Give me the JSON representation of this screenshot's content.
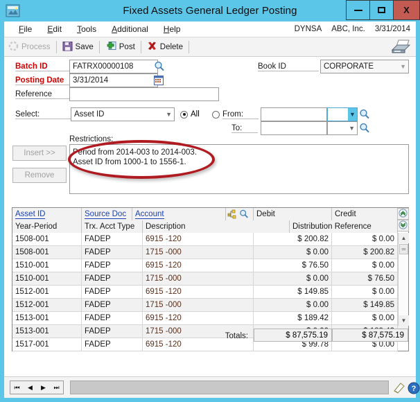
{
  "window": {
    "title": "Fixed Assets General Ledger Posting",
    "app_icon": "app-window-icon",
    "minimize_label": "Minimize",
    "maximize_label": "Maximize",
    "close_label": "X"
  },
  "menubar": {
    "items": [
      {
        "label": "File",
        "accel": "F"
      },
      {
        "label": "Edit",
        "accel": "E"
      },
      {
        "label": "Tools",
        "accel": "T"
      },
      {
        "label": "Additional",
        "accel": "A"
      },
      {
        "label": "Help",
        "accel": "H"
      }
    ],
    "user": "DYNSA",
    "company": "ABC, Inc.",
    "date": "3/31/2014"
  },
  "toolbar": {
    "process_label": "Process",
    "save_label": "Save",
    "post_label": "Post",
    "delete_label": "Delete",
    "print_icon": "printer-icon"
  },
  "form": {
    "batch_id_label": "Batch ID",
    "batch_id_value": "FATRX00000108",
    "posting_date_label": "Posting Date",
    "posting_date_value": "3/31/2014",
    "reference_label": "Reference",
    "reference_value": "",
    "book_id_label": "Book ID",
    "book_id_value": "CORPORATE",
    "select_label": "Select:",
    "select_value": "Asset ID",
    "radio_all_label": "All",
    "radio_all_selected": true,
    "radio_range_selected": false,
    "from_label": "From:",
    "from_value": "",
    "from_code": "",
    "to_label": "To:",
    "to_value": "",
    "to_code": "",
    "restrictions_label": "Restrictions:",
    "restriction_lines": [
      "Period from 2014-003 to 2014-003.",
      "Asset ID from 1000-1 to 1556-1."
    ],
    "insert_label": "Insert >>",
    "remove_label": "Remove"
  },
  "grid": {
    "headers_top": [
      "Asset ID",
      "Source Doc",
      "Account",
      "Debit",
      "Credit"
    ],
    "headers_bottom": [
      "Year-Period",
      "Trx. Acct Type",
      "Description",
      "Distribution Reference"
    ],
    "header_icons": [
      "expand-hierarchy-icon",
      "lookup-magnifier-icon"
    ],
    "scroll_up_icon": "double-chevron-up-icon",
    "scroll_down_icon": "double-chevron-down-icon",
    "rows": [
      {
        "asset_id": "1508-001",
        "source_doc": "FADEP",
        "account": "6915 -120",
        "debit": "$ 200.82",
        "credit": "$ 0.00"
      },
      {
        "asset_id": "1508-001",
        "source_doc": "FADEP",
        "account": "1715 -000",
        "debit": "$ 0.00",
        "credit": "$ 200.82"
      },
      {
        "asset_id": "1510-001",
        "source_doc": "FADEP",
        "account": "6915 -120",
        "debit": "$ 76.50",
        "credit": "$ 0.00"
      },
      {
        "asset_id": "1510-001",
        "source_doc": "FADEP",
        "account": "1715 -000",
        "debit": "$ 0.00",
        "credit": "$ 76.50"
      },
      {
        "asset_id": "1512-001",
        "source_doc": "FADEP",
        "account": "6915 -120",
        "debit": "$ 149.85",
        "credit": "$ 0.00"
      },
      {
        "asset_id": "1512-001",
        "source_doc": "FADEP",
        "account": "1715 -000",
        "debit": "$ 0.00",
        "credit": "$ 149.85"
      },
      {
        "asset_id": "1513-001",
        "source_doc": "FADEP",
        "account": "6915 -120",
        "debit": "$ 189.42",
        "credit": "$ 0.00"
      },
      {
        "asset_id": "1513-001",
        "source_doc": "FADEP",
        "account": "1715 -000",
        "debit": "$ 0.00",
        "credit": "$ 189.42"
      },
      {
        "asset_id": "1517-001",
        "source_doc": "FADEP",
        "account": "6915 -120",
        "debit": "$ 99.78",
        "credit": "$ 0.00"
      }
    ],
    "totals_label": "Totals:",
    "totals_debit": "$ 87,575.19",
    "totals_credit": "$ 87,575.19"
  },
  "statusbar": {
    "nav_first": "first-record-icon",
    "nav_prev": "previous-record-icon",
    "nav_next": "next-record-icon",
    "nav_last": "last-record-icon",
    "note_icon": "note-icon",
    "help_icon": "help-icon",
    "message": ""
  },
  "annotation": {
    "shape": "red-ellipse-highlight",
    "color": "#b01b22"
  }
}
